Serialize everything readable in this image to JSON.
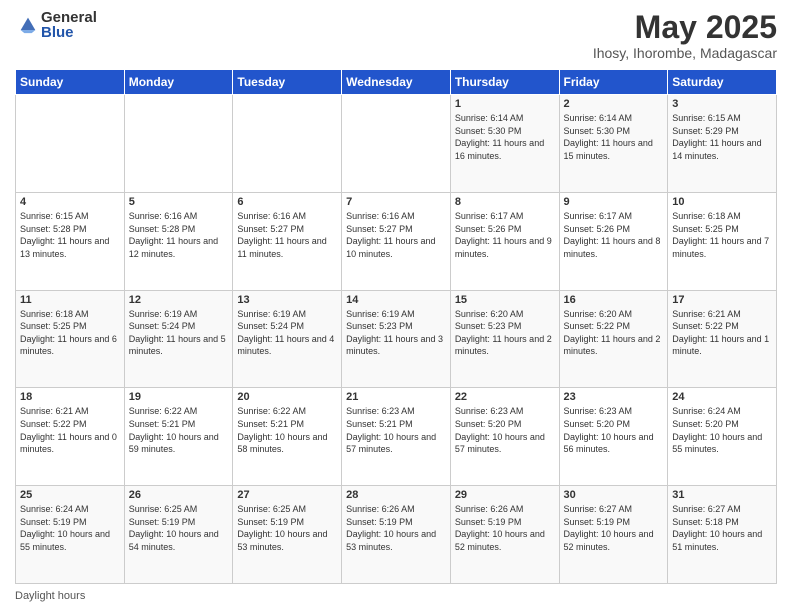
{
  "logo": {
    "general": "General",
    "blue": "Blue"
  },
  "title": "May 2025",
  "location": "Ihosy, Ihorombe, Madagascar",
  "days_of_week": [
    "Sunday",
    "Monday",
    "Tuesday",
    "Wednesday",
    "Thursday",
    "Friday",
    "Saturday"
  ],
  "footer": "Daylight hours",
  "weeks": [
    [
      {
        "day": "",
        "sunrise": "",
        "sunset": "",
        "daylight": ""
      },
      {
        "day": "",
        "sunrise": "",
        "sunset": "",
        "daylight": ""
      },
      {
        "day": "",
        "sunrise": "",
        "sunset": "",
        "daylight": ""
      },
      {
        "day": "",
        "sunrise": "",
        "sunset": "",
        "daylight": ""
      },
      {
        "day": "1",
        "sunrise": "Sunrise: 6:14 AM",
        "sunset": "Sunset: 5:30 PM",
        "daylight": "Daylight: 11 hours and 16 minutes."
      },
      {
        "day": "2",
        "sunrise": "Sunrise: 6:14 AM",
        "sunset": "Sunset: 5:30 PM",
        "daylight": "Daylight: 11 hours and 15 minutes."
      },
      {
        "day": "3",
        "sunrise": "Sunrise: 6:15 AM",
        "sunset": "Sunset: 5:29 PM",
        "daylight": "Daylight: 11 hours and 14 minutes."
      }
    ],
    [
      {
        "day": "4",
        "sunrise": "Sunrise: 6:15 AM",
        "sunset": "Sunset: 5:28 PM",
        "daylight": "Daylight: 11 hours and 13 minutes."
      },
      {
        "day": "5",
        "sunrise": "Sunrise: 6:16 AM",
        "sunset": "Sunset: 5:28 PM",
        "daylight": "Daylight: 11 hours and 12 minutes."
      },
      {
        "day": "6",
        "sunrise": "Sunrise: 6:16 AM",
        "sunset": "Sunset: 5:27 PM",
        "daylight": "Daylight: 11 hours and 11 minutes."
      },
      {
        "day": "7",
        "sunrise": "Sunrise: 6:16 AM",
        "sunset": "Sunset: 5:27 PM",
        "daylight": "Daylight: 11 hours and 10 minutes."
      },
      {
        "day": "8",
        "sunrise": "Sunrise: 6:17 AM",
        "sunset": "Sunset: 5:26 PM",
        "daylight": "Daylight: 11 hours and 9 minutes."
      },
      {
        "day": "9",
        "sunrise": "Sunrise: 6:17 AM",
        "sunset": "Sunset: 5:26 PM",
        "daylight": "Daylight: 11 hours and 8 minutes."
      },
      {
        "day": "10",
        "sunrise": "Sunrise: 6:18 AM",
        "sunset": "Sunset: 5:25 PM",
        "daylight": "Daylight: 11 hours and 7 minutes."
      }
    ],
    [
      {
        "day": "11",
        "sunrise": "Sunrise: 6:18 AM",
        "sunset": "Sunset: 5:25 PM",
        "daylight": "Daylight: 11 hours and 6 minutes."
      },
      {
        "day": "12",
        "sunrise": "Sunrise: 6:19 AM",
        "sunset": "Sunset: 5:24 PM",
        "daylight": "Daylight: 11 hours and 5 minutes."
      },
      {
        "day": "13",
        "sunrise": "Sunrise: 6:19 AM",
        "sunset": "Sunset: 5:24 PM",
        "daylight": "Daylight: 11 hours and 4 minutes."
      },
      {
        "day": "14",
        "sunrise": "Sunrise: 6:19 AM",
        "sunset": "Sunset: 5:23 PM",
        "daylight": "Daylight: 11 hours and 3 minutes."
      },
      {
        "day": "15",
        "sunrise": "Sunrise: 6:20 AM",
        "sunset": "Sunset: 5:23 PM",
        "daylight": "Daylight: 11 hours and 2 minutes."
      },
      {
        "day": "16",
        "sunrise": "Sunrise: 6:20 AM",
        "sunset": "Sunset: 5:22 PM",
        "daylight": "Daylight: 11 hours and 2 minutes."
      },
      {
        "day": "17",
        "sunrise": "Sunrise: 6:21 AM",
        "sunset": "Sunset: 5:22 PM",
        "daylight": "Daylight: 11 hours and 1 minute."
      }
    ],
    [
      {
        "day": "18",
        "sunrise": "Sunrise: 6:21 AM",
        "sunset": "Sunset: 5:22 PM",
        "daylight": "Daylight: 11 hours and 0 minutes."
      },
      {
        "day": "19",
        "sunrise": "Sunrise: 6:22 AM",
        "sunset": "Sunset: 5:21 PM",
        "daylight": "Daylight: 10 hours and 59 minutes."
      },
      {
        "day": "20",
        "sunrise": "Sunrise: 6:22 AM",
        "sunset": "Sunset: 5:21 PM",
        "daylight": "Daylight: 10 hours and 58 minutes."
      },
      {
        "day": "21",
        "sunrise": "Sunrise: 6:23 AM",
        "sunset": "Sunset: 5:21 PM",
        "daylight": "Daylight: 10 hours and 57 minutes."
      },
      {
        "day": "22",
        "sunrise": "Sunrise: 6:23 AM",
        "sunset": "Sunset: 5:20 PM",
        "daylight": "Daylight: 10 hours and 57 minutes."
      },
      {
        "day": "23",
        "sunrise": "Sunrise: 6:23 AM",
        "sunset": "Sunset: 5:20 PM",
        "daylight": "Daylight: 10 hours and 56 minutes."
      },
      {
        "day": "24",
        "sunrise": "Sunrise: 6:24 AM",
        "sunset": "Sunset: 5:20 PM",
        "daylight": "Daylight: 10 hours and 55 minutes."
      }
    ],
    [
      {
        "day": "25",
        "sunrise": "Sunrise: 6:24 AM",
        "sunset": "Sunset: 5:19 PM",
        "daylight": "Daylight: 10 hours and 55 minutes."
      },
      {
        "day": "26",
        "sunrise": "Sunrise: 6:25 AM",
        "sunset": "Sunset: 5:19 PM",
        "daylight": "Daylight: 10 hours and 54 minutes."
      },
      {
        "day": "27",
        "sunrise": "Sunrise: 6:25 AM",
        "sunset": "Sunset: 5:19 PM",
        "daylight": "Daylight: 10 hours and 53 minutes."
      },
      {
        "day": "28",
        "sunrise": "Sunrise: 6:26 AM",
        "sunset": "Sunset: 5:19 PM",
        "daylight": "Daylight: 10 hours and 53 minutes."
      },
      {
        "day": "29",
        "sunrise": "Sunrise: 6:26 AM",
        "sunset": "Sunset: 5:19 PM",
        "daylight": "Daylight: 10 hours and 52 minutes."
      },
      {
        "day": "30",
        "sunrise": "Sunrise: 6:27 AM",
        "sunset": "Sunset: 5:19 PM",
        "daylight": "Daylight: 10 hours and 52 minutes."
      },
      {
        "day": "31",
        "sunrise": "Sunrise: 6:27 AM",
        "sunset": "Sunset: 5:18 PM",
        "daylight": "Daylight: 10 hours and 51 minutes."
      }
    ]
  ]
}
